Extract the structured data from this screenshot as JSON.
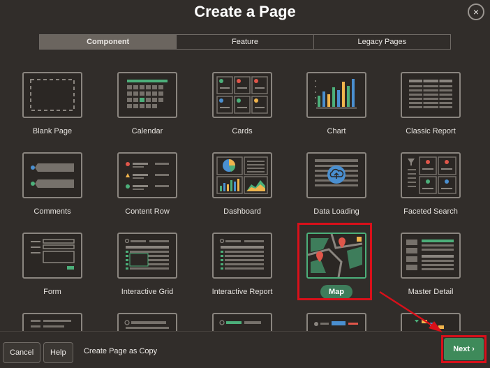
{
  "dialog": {
    "title": "Create a Page",
    "close_label": "×"
  },
  "tabs": [
    {
      "label": "Component",
      "active": true
    },
    {
      "label": "Feature",
      "active": false
    },
    {
      "label": "Legacy Pages",
      "active": false
    }
  ],
  "tiles": [
    {
      "label": "Blank Page",
      "icon": "blank-page-icon"
    },
    {
      "label": "Calendar",
      "icon": "calendar-icon"
    },
    {
      "label": "Cards",
      "icon": "cards-icon"
    },
    {
      "label": "Chart",
      "icon": "chart-icon"
    },
    {
      "label": "Classic Report",
      "icon": "classic-report-icon"
    },
    {
      "label": "Comments",
      "icon": "comments-icon"
    },
    {
      "label": "Content Row",
      "icon": "content-row-icon"
    },
    {
      "label": "Dashboard",
      "icon": "dashboard-icon"
    },
    {
      "label": "Data Loading",
      "icon": "data-loading-icon"
    },
    {
      "label": "Faceted Search",
      "icon": "faceted-search-icon"
    },
    {
      "label": "Form",
      "icon": "form-icon"
    },
    {
      "label": "Interactive Grid",
      "icon": "interactive-grid-icon"
    },
    {
      "label": "Interactive Report",
      "icon": "interactive-report-icon"
    },
    {
      "label": "Map",
      "icon": "map-icon",
      "selected": true
    },
    {
      "label": "Master Detail",
      "icon": "master-detail-icon"
    }
  ],
  "footer": {
    "cancel_label": "Cancel",
    "help_label": "Help",
    "copy_label": "Create Page as Copy",
    "next_label": "Next",
    "next_icon": "chevron-right-icon"
  },
  "colors": {
    "accent_green": "#3e7d5b",
    "highlight_red": "#d8101a",
    "background": "#312d2a"
  }
}
